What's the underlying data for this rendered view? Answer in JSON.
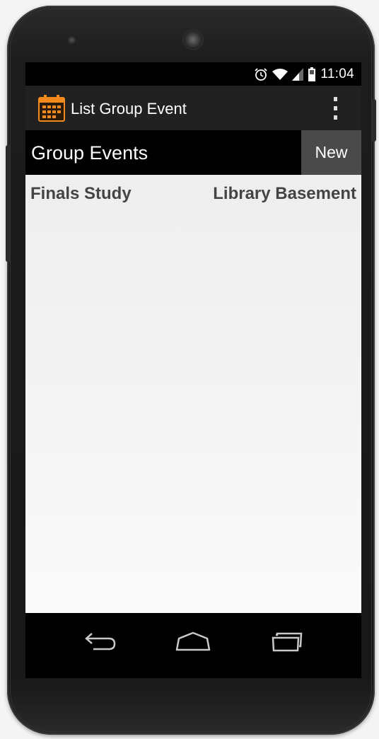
{
  "status_bar": {
    "time": "11:04",
    "icons": [
      "alarm-icon",
      "wifi-icon",
      "signal-icon",
      "battery-icon"
    ]
  },
  "action_bar": {
    "title": "List Group Event",
    "app_icon": "calendar-icon",
    "menu_icon": "overflow-menu-icon",
    "accent_color": "#f28a1e"
  },
  "header": {
    "title": "Group Events",
    "new_label": "New"
  },
  "events": [
    {
      "name": "Finals Study",
      "location": "Library Basement"
    }
  ],
  "nav_bar": {
    "buttons": [
      "back-icon",
      "home-icon",
      "recent-apps-icon"
    ]
  }
}
